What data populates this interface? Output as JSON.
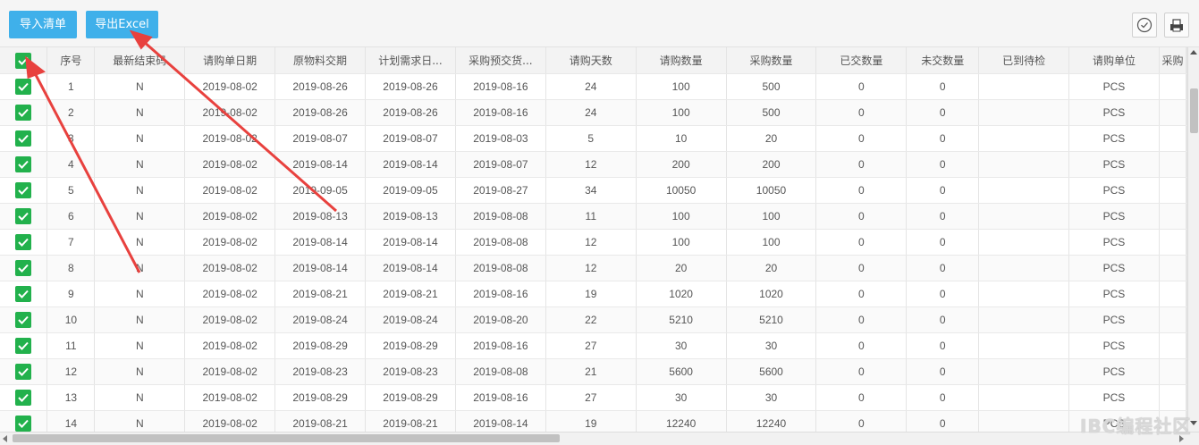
{
  "toolbar": {
    "import_label": "导入清单",
    "export_label": "导出Excel"
  },
  "columns": [
    "序号",
    "最新结束码",
    "请购单日期",
    "原物料交期",
    "计划需求日...",
    "采购预交货...",
    "请购天数",
    "请购数量",
    "采购数量",
    "已交数量",
    "未交数量",
    "已到待检",
    "请购单位",
    "采购"
  ],
  "rows": [
    [
      "1",
      "N",
      "2019-08-02",
      "2019-08-26",
      "2019-08-26",
      "2019-08-16",
      "24",
      "100",
      "500",
      "0",
      "0",
      "",
      "PCS"
    ],
    [
      "2",
      "N",
      "2019-08-02",
      "2019-08-26",
      "2019-08-26",
      "2019-08-16",
      "24",
      "100",
      "500",
      "0",
      "0",
      "",
      "PCS"
    ],
    [
      "3",
      "N",
      "2019-08-02",
      "2019-08-07",
      "2019-08-07",
      "2019-08-03",
      "5",
      "10",
      "20",
      "0",
      "0",
      "",
      "PCS"
    ],
    [
      "4",
      "N",
      "2019-08-02",
      "2019-08-14",
      "2019-08-14",
      "2019-08-07",
      "12",
      "200",
      "200",
      "0",
      "0",
      "",
      "PCS"
    ],
    [
      "5",
      "N",
      "2019-08-02",
      "2019-09-05",
      "2019-09-05",
      "2019-08-27",
      "34",
      "10050",
      "10050",
      "0",
      "0",
      "",
      "PCS"
    ],
    [
      "6",
      "N",
      "2019-08-02",
      "2019-08-13",
      "2019-08-13",
      "2019-08-08",
      "11",
      "100",
      "100",
      "0",
      "0",
      "",
      "PCS"
    ],
    [
      "7",
      "N",
      "2019-08-02",
      "2019-08-14",
      "2019-08-14",
      "2019-08-08",
      "12",
      "100",
      "100",
      "0",
      "0",
      "",
      "PCS"
    ],
    [
      "8",
      "N",
      "2019-08-02",
      "2019-08-14",
      "2019-08-14",
      "2019-08-08",
      "12",
      "20",
      "20",
      "0",
      "0",
      "",
      "PCS"
    ],
    [
      "9",
      "N",
      "2019-08-02",
      "2019-08-21",
      "2019-08-21",
      "2019-08-16",
      "19",
      "1020",
      "1020",
      "0",
      "0",
      "",
      "PCS"
    ],
    [
      "10",
      "N",
      "2019-08-02",
      "2019-08-24",
      "2019-08-24",
      "2019-08-20",
      "22",
      "5210",
      "5210",
      "0",
      "0",
      "",
      "PCS"
    ],
    [
      "11",
      "N",
      "2019-08-02",
      "2019-08-29",
      "2019-08-29",
      "2019-08-16",
      "27",
      "30",
      "30",
      "0",
      "0",
      "",
      "PCS"
    ],
    [
      "12",
      "N",
      "2019-08-02",
      "2019-08-23",
      "2019-08-23",
      "2019-08-08",
      "21",
      "5600",
      "5600",
      "0",
      "0",
      "",
      "PCS"
    ],
    [
      "13",
      "N",
      "2019-08-02",
      "2019-08-29",
      "2019-08-29",
      "2019-08-16",
      "27",
      "30",
      "30",
      "0",
      "0",
      "",
      "PCS"
    ],
    [
      "14",
      "N",
      "2019-08-02",
      "2019-08-21",
      "2019-08-21",
      "2019-08-14",
      "19",
      "12240",
      "12240",
      "0",
      "0",
      "",
      "PCS"
    ]
  ],
  "icons": {
    "check_circle": "check-circle-icon",
    "print": "print-icon",
    "checkbox": "checkbox-checked-icon"
  },
  "colors": {
    "button": "#3fb0ea",
    "checkbox": "#22b14c",
    "annotation_arrow": "#e8413e"
  },
  "watermark": "IBC编程社区"
}
